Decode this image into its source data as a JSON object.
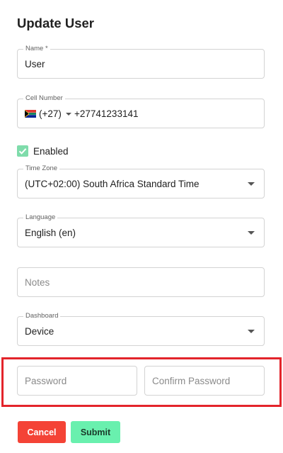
{
  "title": "Update User",
  "name": {
    "label": "Name *",
    "value": "User"
  },
  "cell": {
    "label": "Cell Number",
    "dial_code": "(+27)",
    "number": "+27741233141",
    "flag_icon": "south-africa-flag-icon"
  },
  "enabled": {
    "label": "Enabled",
    "checked": true,
    "color": "#7fdcab"
  },
  "timezone": {
    "label": "Time Zone",
    "value": "(UTC+02:00) South Africa Standard Time"
  },
  "language": {
    "label": "Language",
    "value": "English (en)"
  },
  "notes": {
    "placeholder": "Notes"
  },
  "dashboard": {
    "label": "Dashboard",
    "value": "Device"
  },
  "password": {
    "placeholder": "Password"
  },
  "confirm_password": {
    "placeholder": "Confirm Password"
  },
  "actions": {
    "cancel_label": "Cancel",
    "submit_label": "Submit"
  },
  "colors": {
    "cancel": "#f44336",
    "submit": "#69f0ae",
    "highlight": "#e3242b"
  }
}
